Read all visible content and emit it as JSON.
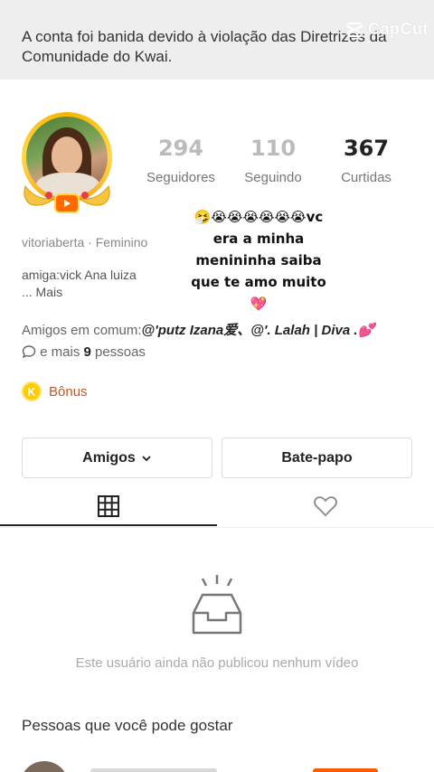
{
  "banner": {
    "message": "A conta foi banida devido à violação das Diretrizes da Comunidade do Kwai.",
    "watermark": "CapCut"
  },
  "profile": {
    "username": "vitoriaberta",
    "gender": "Feminino",
    "bio": "amiga:vick Ana luiza",
    "bio_more": "... Mais"
  },
  "stats": {
    "followers": {
      "value": "294",
      "label": "Seguidores"
    },
    "following": {
      "value": "110",
      "label": "Seguindo"
    },
    "likes": {
      "value": "367",
      "label": "Curtidas"
    }
  },
  "overlay": {
    "line1": "🤧😭😭😭😭😭😭vc",
    "line2": "era a minha",
    "line3": "menininha saiba",
    "line4": "que te amo muito",
    "line5": "💖"
  },
  "friends": {
    "label": "Amigos em comum:",
    "names": "@'putz Izana爱、@'. Lalah | Diva .💕",
    "more_prefix": "e mais",
    "count": "9",
    "more_suffix": "pessoas"
  },
  "bonus": {
    "label": "Bônus",
    "coin": "K"
  },
  "buttons": {
    "friends": "Amigos",
    "chat": "Bate-papo"
  },
  "tabs": [
    {
      "name": "videos",
      "icon": "grid-icon"
    },
    {
      "name": "likes",
      "icon": "heart-outline-icon"
    }
  ],
  "empty_state": {
    "message": "Este usuário ainda não publicou nenhum vídeo"
  },
  "suggestions": {
    "title": "Pessoas que você pode gostar"
  },
  "colors": {
    "accent": "#ff5a00",
    "bonus_text": "#c0562b",
    "coin": "#ffcc00",
    "banner_bg": "#eeeeee"
  }
}
